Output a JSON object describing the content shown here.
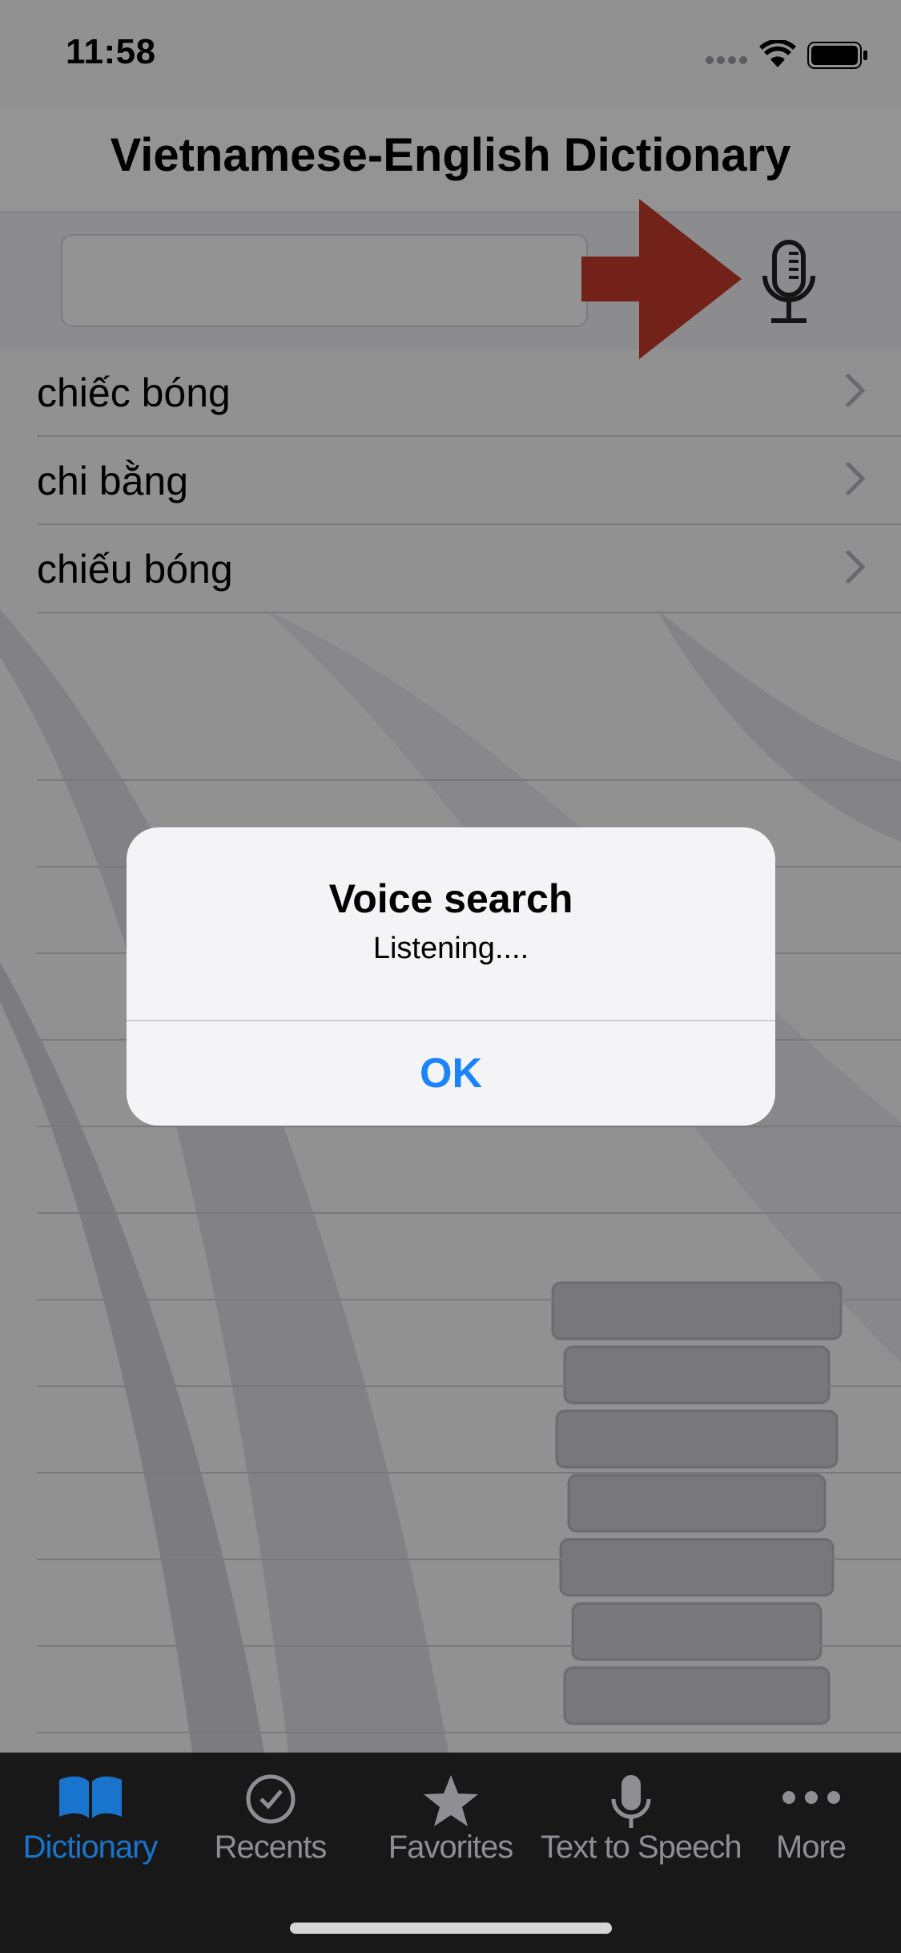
{
  "status_bar": {
    "time": "11:58"
  },
  "header": {
    "title": "Vietnamese-English Dictionary"
  },
  "search": {
    "value": "",
    "placeholder": ""
  },
  "results": [
    {
      "word": "chiếc bóng"
    },
    {
      "word": "chi bằng"
    },
    {
      "word": "chiếu bóng"
    }
  ],
  "alert": {
    "title": "Voice search",
    "message": "Listening....",
    "ok_label": "OK"
  },
  "tabs": [
    {
      "label": "Dictionary",
      "icon": "book-icon",
      "active": true
    },
    {
      "label": "Recents",
      "icon": "clock-icon",
      "active": false
    },
    {
      "label": "Favorites",
      "icon": "star-icon",
      "active": false
    },
    {
      "label": "Text to Speech",
      "icon": "microphone-icon",
      "active": false
    },
    {
      "label": "More",
      "icon": "more-dots-icon",
      "active": false
    }
  ],
  "colors": {
    "accent": "#1874cd",
    "alert_button": "#1a84ff",
    "annotation_arrow": "#c0392b",
    "tabbar_bg": "#181818"
  }
}
